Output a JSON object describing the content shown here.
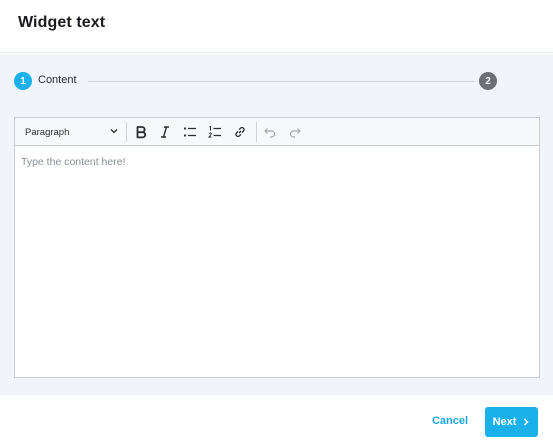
{
  "dialog": {
    "title": "Widget text"
  },
  "stepper": {
    "steps": [
      {
        "number": "1",
        "label": "Content",
        "active": true
      },
      {
        "number": "2",
        "label": "",
        "active": false
      }
    ]
  },
  "editor": {
    "format_select": {
      "value": "Paragraph"
    },
    "toolbar_icons": [
      "bold-icon",
      "italic-icon",
      "bulleted-list-icon",
      "numbered-list-icon",
      "link-icon",
      "undo-icon",
      "redo-icon"
    ],
    "placeholder": "Type the content here!"
  },
  "footer": {
    "cancel_label": "Cancel",
    "next_label": "Next"
  },
  "colors": {
    "accent": "#1ab0ea",
    "inactive_step": "#6c6f74",
    "body_background": "#f1f4f8"
  }
}
